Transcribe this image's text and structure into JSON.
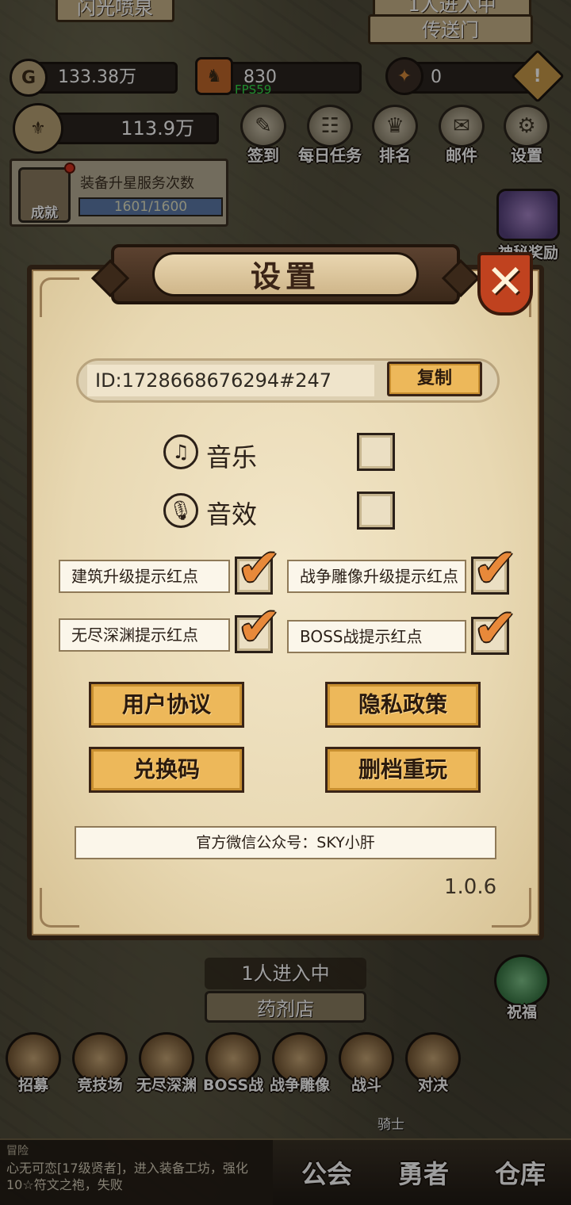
{
  "background": {
    "top_left_sign": "闪光喷泉",
    "top_right_status": "1人进入中",
    "top_right_sign": "传送门"
  },
  "resources": {
    "gold": "133.38万",
    "gems": "830",
    "tokens": "0",
    "power": "113.9万",
    "fps": "FPS59"
  },
  "top_menu": [
    {
      "label": "签到",
      "icon": "scroll-icon"
    },
    {
      "label": "每日任务",
      "icon": "task-board-icon"
    },
    {
      "label": "排名",
      "icon": "laurel-crown-icon"
    },
    {
      "label": "邮件",
      "icon": "envelope-icon"
    },
    {
      "label": "设置",
      "icon": "gear-icon"
    }
  ],
  "achievement": {
    "title": "装备升星服务次数",
    "progress": "1601/1600",
    "badge_label": "成就"
  },
  "side": {
    "mystery_reward": "神秘奖励",
    "blessing": "祝福"
  },
  "dialog": {
    "title": "设置",
    "id_text": "ID:1728668676294#247",
    "copy_label": "复制",
    "music_label": "音乐",
    "sfx_label": "音效",
    "music_checked": false,
    "sfx_checked": false,
    "toggles": [
      {
        "label": "建筑升级提示红点",
        "checked": true
      },
      {
        "label": "战争雕像升级提示红点",
        "checked": true
      },
      {
        "label": "无尽深渊提示红点",
        "checked": true
      },
      {
        "label": "BOSS战提示红点",
        "checked": true
      }
    ],
    "buttons": {
      "user_agreement": "用户协议",
      "privacy_policy": "隐私政策",
      "redeem_code": "兑换码",
      "reset_save": "删档重玩"
    },
    "wechat": "官方微信公众号：SKY小肝",
    "version": "1.0.6"
  },
  "building": {
    "status": "1人进入中",
    "name": "药剂店"
  },
  "bottom_menu": [
    {
      "label": "招募",
      "icon": "recruit-icon"
    },
    {
      "label": "竞技场",
      "icon": "target-icon"
    },
    {
      "label": "无尽深渊",
      "icon": "abyss-icon"
    },
    {
      "label": "BOSS战",
      "icon": "helmet-icon"
    },
    {
      "label": "战争雕像",
      "icon": "statue-icon"
    },
    {
      "label": "战斗",
      "icon": "crossed-swords-icon"
    },
    {
      "label": "对决",
      "icon": "fist-icon"
    }
  ],
  "knight_label": "骑士",
  "log": {
    "title": "冒险",
    "message": "心无可恋[17级贤者]，进入装备工坊，强化10☆符文之袍，失败"
  },
  "tabs": [
    "公会",
    "勇者",
    "仓库"
  ]
}
